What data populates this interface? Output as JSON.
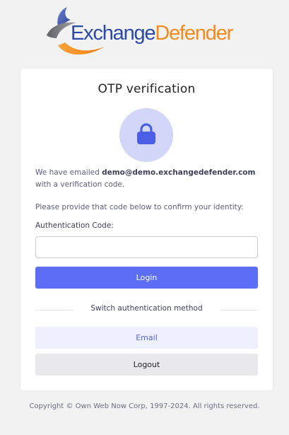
{
  "brand": {
    "logo_word1": "Exchange",
    "logo_word2": "Defender",
    "primary_color": "#2b4aa6",
    "accent_color": "#f28a1e"
  },
  "card": {
    "title": "OTP verification",
    "lock_icon": "lock-icon",
    "message_prefix": "We have emailed ",
    "email": "demo@demo.exchangedefender.com",
    "message_suffix": "with a verification code.",
    "instruction": "Please provide that code below to confirm your identity:",
    "code_label": "Authentication Code:",
    "code_value": "",
    "code_placeholder": "",
    "login_label": "Login",
    "switch_label": "Switch authentication method",
    "email_button_label": "Email",
    "logout_label": "Logout",
    "login_color": "#5b6ef5"
  },
  "footer": {
    "copyright": "Copyright © Own Web Now Corp, 1997-2024. All rights reserved."
  }
}
